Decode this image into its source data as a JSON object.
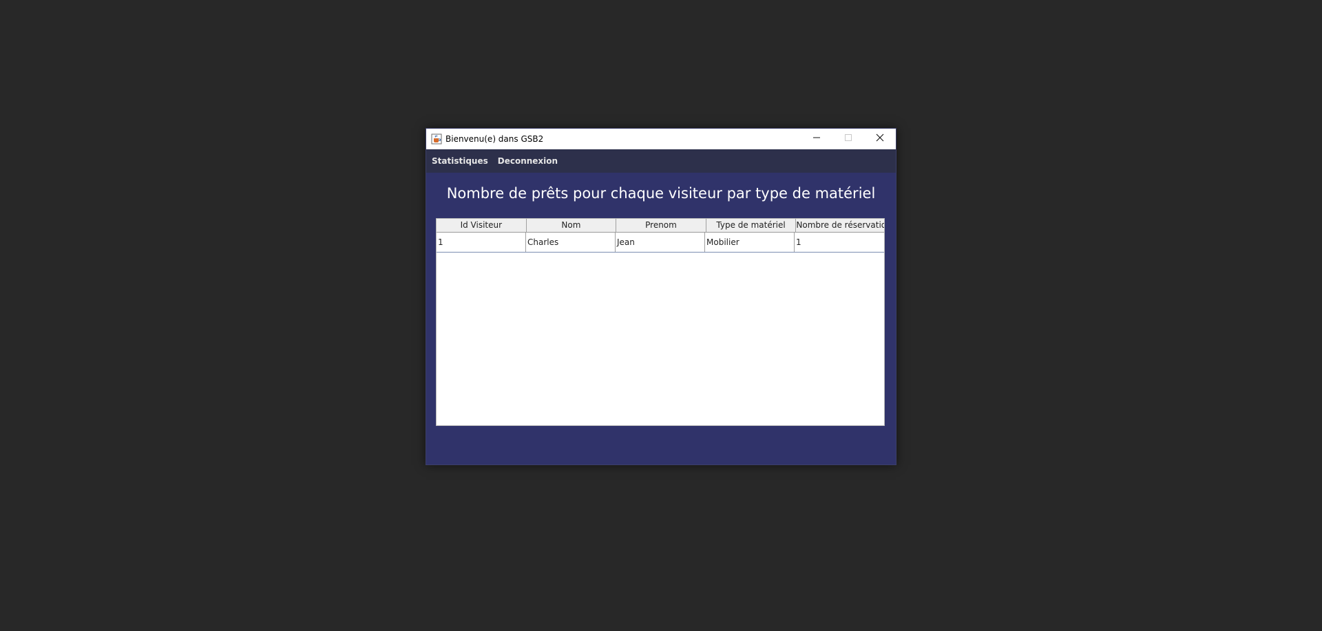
{
  "window": {
    "title": "Bienvenu(e) dans GSB2"
  },
  "menu": {
    "items": [
      {
        "label": "Statistiques"
      },
      {
        "label": "Deconnexion"
      }
    ]
  },
  "main": {
    "heading": "Nombre de prêts pour chaque visiteur par type de matériel"
  },
  "table": {
    "columns": [
      "Id Visiteur",
      "Nom",
      "Prenom",
      "Type de matériel",
      "Nombre de réservatio..."
    ],
    "rows": [
      [
        "1",
        "Charles",
        "Jean",
        "Mobilier",
        "1"
      ]
    ]
  },
  "colors": {
    "desktop": "#282828",
    "window_body": "#30336a",
    "menubar": "#2d304b"
  },
  "icons": {
    "app": "java-cup-icon",
    "minimize": "minimize-icon",
    "maximize": "maximize-icon",
    "close": "close-icon"
  }
}
